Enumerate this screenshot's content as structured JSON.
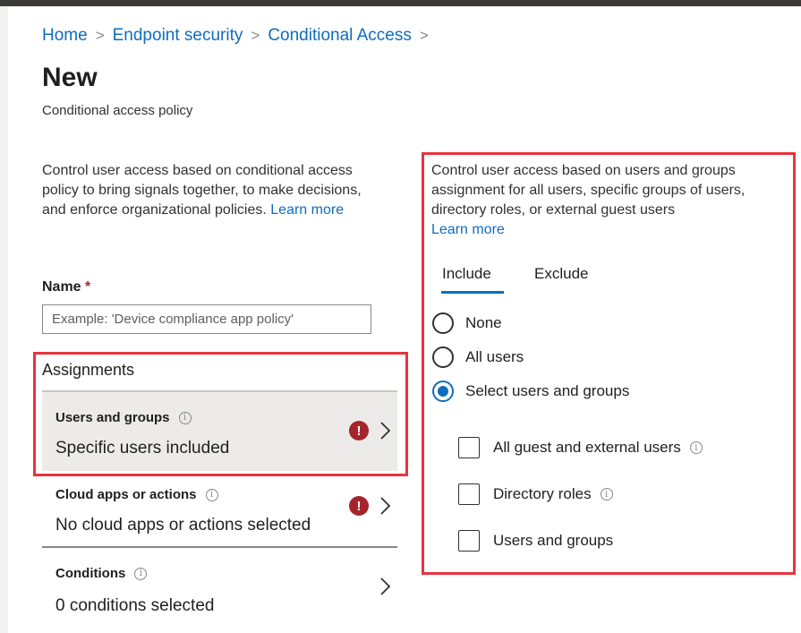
{
  "breadcrumb": [
    "Home",
    "Endpoint security",
    "Conditional Access"
  ],
  "page": {
    "title": "New",
    "subtitle": "Conditional access policy"
  },
  "left": {
    "description": "Control user access based on conditional access policy to bring signals together, to make decisions, and enforce organizational policies.",
    "learn_more": "Learn more",
    "name_label": "Name",
    "name_required_mark": "*",
    "name_placeholder": "Example: 'Device compliance app policy'",
    "name_value": "",
    "assignments_heading": "Assignments",
    "items": [
      {
        "title": "Users and groups",
        "subtitle": "Specific users included",
        "error": true,
        "info_icon": "info-icon",
        "selected": true
      },
      {
        "title": "Cloud apps or actions",
        "subtitle": "No cloud apps or actions selected",
        "error": true,
        "info_icon": "info-icon",
        "selected": false
      },
      {
        "title": "Conditions",
        "subtitle": "0 conditions selected",
        "error": false,
        "info_icon": "info-icon",
        "selected": false
      }
    ]
  },
  "right": {
    "description": "Control user access based on users and groups assignment for all users, specific groups of users, directory roles, or external guest users",
    "learn_more": "Learn more",
    "tabs": [
      {
        "label": "Include",
        "active": true
      },
      {
        "label": "Exclude",
        "active": false
      }
    ],
    "radios": [
      {
        "label": "None",
        "checked": false
      },
      {
        "label": "All users",
        "checked": false
      },
      {
        "label": "Select users and groups",
        "checked": true
      }
    ],
    "checkboxes": [
      {
        "label": "All guest and external users",
        "checked": false,
        "info": true
      },
      {
        "label": "Directory roles",
        "checked": false,
        "info": true
      },
      {
        "label": "Users and groups",
        "checked": false,
        "info": false
      }
    ]
  },
  "colors": {
    "link": "#0f6cbd",
    "highlight_border": "#e8333f",
    "error": "#a4262c",
    "selected_bg": "#edebe9"
  },
  "icons": {
    "error": "error-icon",
    "info": "info-icon",
    "chevron": "chevron-right-icon"
  }
}
